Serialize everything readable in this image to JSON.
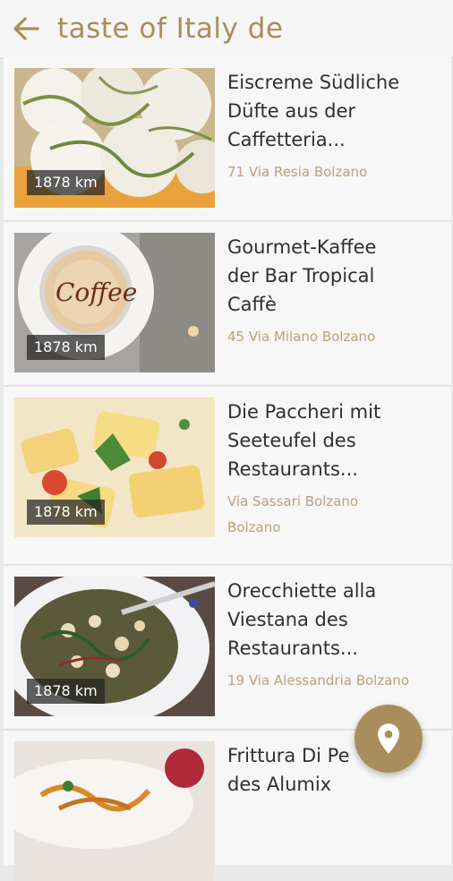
{
  "header": {
    "back_icon": "arrow-left-icon",
    "title": "taste of Italy de"
  },
  "items": [
    {
      "name": "Eiscreme Südliche\nDüfte aus der\nCaffetteria...",
      "address": "71 Via Resia Bolzano",
      "distance": "1878 km",
      "image": "ice-cream-photo"
    },
    {
      "name": "Gourmet-Kaffee\nder Bar Tropical\nCaffè",
      "address": "45 Via Milano Bolzano",
      "distance": "1878 km",
      "image": "coffee-cup-photo"
    },
    {
      "name": "Die Paccheri mit\nSeeteufel des\nRestaurants...",
      "address": "Via Sassari Bolzano\nBolzano",
      "distance": "1878 km",
      "image": "paccheri-pasta-photo"
    },
    {
      "name": "Orecchiette alla\nViestana des\nRestaurants...",
      "address": "19 Via Alessandria Bolzano",
      "distance": "1878 km",
      "image": "orecchiette-photo"
    },
    {
      "name": "Frittura Di Pe\ndes Alumix",
      "address": "",
      "distance": "",
      "image": "fried-food-photo"
    }
  ],
  "fab": {
    "icon": "map-pin-icon"
  },
  "colors": {
    "accent": "#a98d5a",
    "address": "#b8a27c",
    "card": "#f7f7f7",
    "background": "#e9e9e9"
  }
}
